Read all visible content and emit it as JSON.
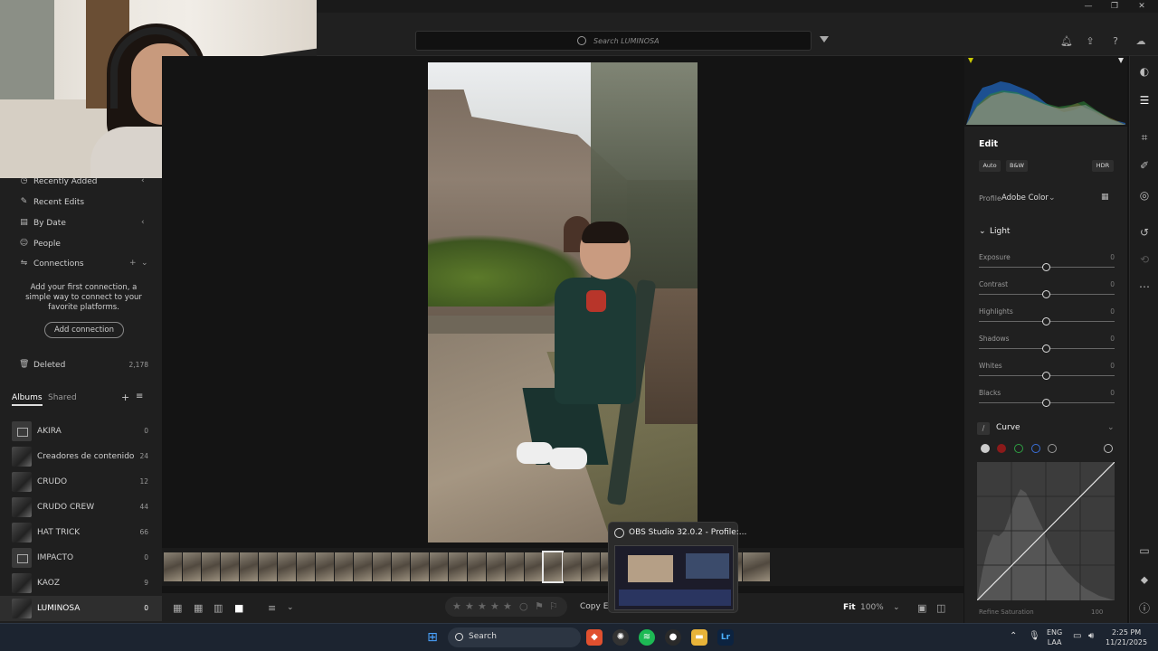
{
  "window": {
    "minimize": "—",
    "restore": "❐",
    "close": "✕"
  },
  "header": {
    "search_placeholder": "Search LUMINOSA"
  },
  "sidebar": {
    "nav": [
      {
        "label": "Recently Added",
        "icon": "clock-icon"
      },
      {
        "label": "Recent Edits",
        "icon": "edit-icon"
      },
      {
        "label": "By Date",
        "icon": "calendar-icon"
      },
      {
        "label": "People",
        "icon": "person-icon"
      },
      {
        "label": "Connections",
        "icon": "connections-icon"
      }
    ],
    "connections_message": "Add your first connection, a simple way to connect to your favorite platforms.",
    "add_connection_label": "Add connection",
    "deleted": {
      "label": "Deleted",
      "count": "2,178"
    },
    "tabs": {
      "albums": "Albums",
      "shared": "Shared"
    },
    "albums": [
      {
        "name": "AKIRA",
        "count": "0",
        "thumb": "empty"
      },
      {
        "name": "Creadores de contenido",
        "count": "24",
        "thumb": "photo"
      },
      {
        "name": "CRUDO",
        "count": "12",
        "thumb": "photo"
      },
      {
        "name": "CRUDO CREW",
        "count": "44",
        "thumb": "photo"
      },
      {
        "name": "HAT TRICK",
        "count": "66",
        "thumb": "photo"
      },
      {
        "name": "IMPACTO",
        "count": "0",
        "thumb": "empty"
      },
      {
        "name": "KAOZ",
        "count": "9",
        "thumb": "photo"
      },
      {
        "name": "LUMINOSA",
        "count": "0",
        "thumb": "photo",
        "selected": true
      }
    ]
  },
  "bottombar": {
    "copy_edits": "Copy Ed",
    "fit": "Fit",
    "zoom": "100%"
  },
  "obs_popup": {
    "title": "OBS Studio 32.0.2 - Profile:..."
  },
  "edit_panel": {
    "title": "Edit",
    "auto": "Auto",
    "bw": "B&W",
    "hdr": "HDR",
    "profile_label": "Profile",
    "profile_value": "Adobe Color",
    "light_section": "Light",
    "sliders": [
      {
        "label": "Exposure",
        "value": "0",
        "level": 0.5
      },
      {
        "label": "Contrast",
        "value": "0",
        "level": 0.5
      },
      {
        "label": "Highlights",
        "value": "0",
        "level": 0.5
      },
      {
        "label": "Shadows",
        "value": "0",
        "level": 0.5
      },
      {
        "label": "Whites",
        "value": "0",
        "level": 0.5
      },
      {
        "label": "Blacks",
        "value": "0",
        "level": 0.5
      }
    ],
    "curve_section": "Curve",
    "refine_saturation": "Refine Saturation",
    "refine_value": "100"
  },
  "taskbar": {
    "search_label": "Search",
    "lang_line1": "ENG",
    "lang_line2": "LAA",
    "time": "2:25 PM",
    "date": "11/21/2025"
  }
}
